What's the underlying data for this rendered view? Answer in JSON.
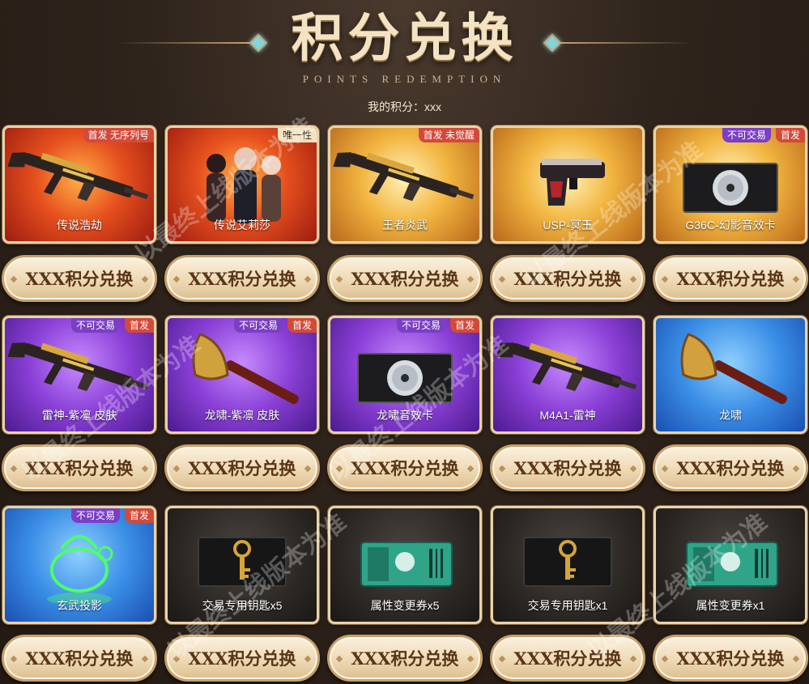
{
  "header": {
    "title": "积分兑换",
    "subtitle": "POINTS REDEMPTION",
    "points_label": "我的积分：xxx"
  },
  "colors": {
    "accent_gold": "#c9a470",
    "tag_red": "#d24a3a",
    "tag_purple": "#7a3fc4"
  },
  "items": [
    {
      "name": "传说浩劫",
      "bg": "red",
      "icon": "rifle-icon",
      "tags": [
        "首发 无序列号"
      ],
      "button": "XXX积分兑换"
    },
    {
      "name": "传说艾莉莎",
      "bg": "red",
      "icon": "characters-icon",
      "tags": [
        "唯一性"
      ],
      "button": "XXX积分兑换"
    },
    {
      "name": "王者炎武",
      "bg": "gold",
      "icon": "rifle-icon",
      "tags": [
        "首发 未觉醒"
      ],
      "button": "XXX积分兑换"
    },
    {
      "name": "USP-冥王",
      "bg": "gold",
      "icon": "pistol-icon",
      "tags": [],
      "button": "XXX积分兑换"
    },
    {
      "name": "G36C-幻影音效卡",
      "bg": "gold",
      "icon": "sound-card-icon",
      "tags": [
        "不可交易",
        "首发"
      ],
      "button": "XXX积分兑换"
    },
    {
      "name": "雷神-紫凛 皮肤",
      "bg": "purple",
      "icon": "rifle-icon",
      "tags": [
        "不可交易",
        "首发"
      ],
      "button": "XXX积分兑换"
    },
    {
      "name": "龙啸-紫凛 皮肤",
      "bg": "purple",
      "icon": "axe-icon",
      "tags": [
        "不可交易",
        "首发"
      ],
      "button": "XXX积分兑换"
    },
    {
      "name": "龙啸音效卡",
      "bg": "purple",
      "icon": "sound-card-icon",
      "tags": [
        "不可交易",
        "首发"
      ],
      "button": "XXX积分兑换"
    },
    {
      "name": "M4A1-雷神",
      "bg": "purple",
      "icon": "rifle-icon",
      "tags": [],
      "button": "XXX积分兑换"
    },
    {
      "name": "龙啸",
      "bg": "blue",
      "icon": "axe-icon",
      "tags": [],
      "button": "XXX积分兑换"
    },
    {
      "name": "玄武投影",
      "bg": "blue",
      "icon": "turtle-hologram-icon",
      "tags": [
        "不可交易",
        "首发"
      ],
      "button": "XXX积分兑换"
    },
    {
      "name": "交易专用钥匙x5",
      "bg": "dark",
      "icon": "key-icon",
      "tags": [],
      "button": "XXX积分兑换"
    },
    {
      "name": "属性变更券x5",
      "bg": "dark",
      "icon": "ticket-icon",
      "tags": [],
      "button": "XXX积分兑换"
    },
    {
      "name": "交易专用钥匙x1",
      "bg": "dark",
      "icon": "key-icon",
      "tags": [],
      "button": "XXX积分兑换"
    },
    {
      "name": "属性变更券x1",
      "bg": "dark",
      "icon": "ticket-icon",
      "tags": [],
      "button": "XXX积分兑换"
    }
  ],
  "watermark": "以最终上线版本为准"
}
